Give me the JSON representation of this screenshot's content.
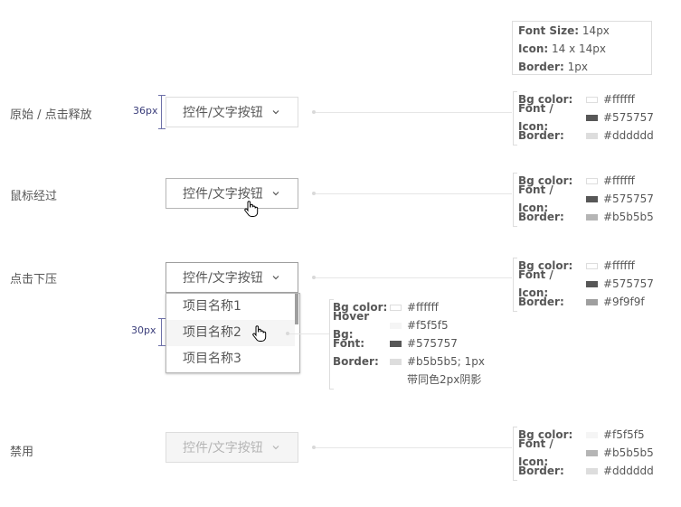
{
  "dropdown_label": "控件/文字按钮",
  "base_spec": {
    "font_size_key": "Font Size:",
    "font_size_val": "14px",
    "icon_key": "Icon:",
    "icon_val": "14 x 14px",
    "border_key": "Border:",
    "border_val": "1px"
  },
  "states": [
    {
      "label": "原始 / 点击释放",
      "bg_key": "Bg color:",
      "bg_val": "#ffffff",
      "font_key": "Font / Icon:",
      "font_val": "#575757",
      "border_key": "Border:",
      "border_val": "#dddddd"
    },
    {
      "label": "鼠标经过",
      "bg_key": "Bg color:",
      "bg_val": "#ffffff",
      "font_key": "Font / Icon:",
      "font_val": "#575757",
      "border_key": "Border:",
      "border_val": "#b5b5b5"
    },
    {
      "label": "点击下压",
      "bg_key": "Bg color:",
      "bg_val": "#ffffff",
      "font_key": "Font / Icon:",
      "font_val": "#575757",
      "border_key": "Border:",
      "border_val": "#9f9f9f"
    },
    {
      "label": "禁用",
      "bg_key": "Bg color:",
      "bg_val": "#f5f5f5",
      "font_key": "Font / Icon:",
      "font_val": "#b5b5b5",
      "border_key": "Border:",
      "border_val": "#dddddd"
    }
  ],
  "menu": {
    "items": [
      "项目名称1",
      "项目名称2",
      "项目名称3"
    ],
    "spec": {
      "bg_key": "Bg color:",
      "bg_val": "#ffffff",
      "hover_key": "Hover Bg:",
      "hover_val": "#f5f5f5",
      "font_key": "Font:",
      "font_val": "#575757",
      "border_key": "Border:",
      "border_val": "#b5b5b5; 1px",
      "shadow_note": "带同色2px阴影"
    }
  },
  "dims": {
    "height_36": "36px",
    "height_30": "30px"
  },
  "colors": {
    "text": "#575757",
    "border": "#dddddd",
    "hover_border": "#b5b5b5",
    "press_border": "#9f9f9f",
    "disabled_bg": "#f5f5f5",
    "disabled_text": "#b5b5b5",
    "hover_bg": "#f5f5f5",
    "dim_color": "#3a3d7a"
  },
  "icons": [
    "chevron-down-icon",
    "hand-pointer-icon"
  ]
}
